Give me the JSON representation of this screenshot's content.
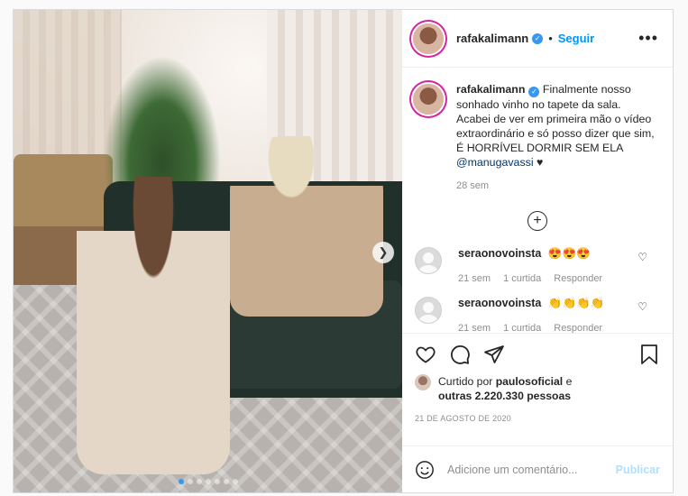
{
  "post": {
    "username": "rafakalimann",
    "follow_label": "Seguir",
    "more_label": "•••",
    "caption_text": "Finalmente nosso sonhado vinho no tapete da sala. Acabei de ver em primeira mão o vídeo extraordinário e só posso dizer que sim, É HORRÍVEL DORMIR SEM ELA",
    "caption_mention": "@manugavassi",
    "caption_suffix": "♥",
    "caption_time": "28 sem",
    "load_more_icon": "plus-circle-icon",
    "next_icon": "chevron-right-icon",
    "carousel_count": 7,
    "carousel_active": 1
  },
  "comments": [
    {
      "username": "seraonovoinsta",
      "text": "😍😍😍",
      "time": "21 sem",
      "likes": "1 curtida",
      "reply": "Responder"
    },
    {
      "username": "seraonovoinsta",
      "text": "👏👏👏👏",
      "time": "21 sem",
      "likes": "1 curtida",
      "reply": "Responder"
    }
  ],
  "likes": {
    "prefix": "Curtido por",
    "user": "paulosoficial",
    "joiner": "e",
    "others": "outras 2.220.330 pessoas"
  },
  "date": "21 DE AGOSTO DE 2020",
  "add_comment": {
    "placeholder": "Adicione um comentário...",
    "publish_label": "Publicar"
  },
  "colors": {
    "accent": "#0095f6",
    "publish_disabled": "#b2dffc",
    "muted": "#8e8e8e",
    "story_ring": "#d6249f"
  }
}
